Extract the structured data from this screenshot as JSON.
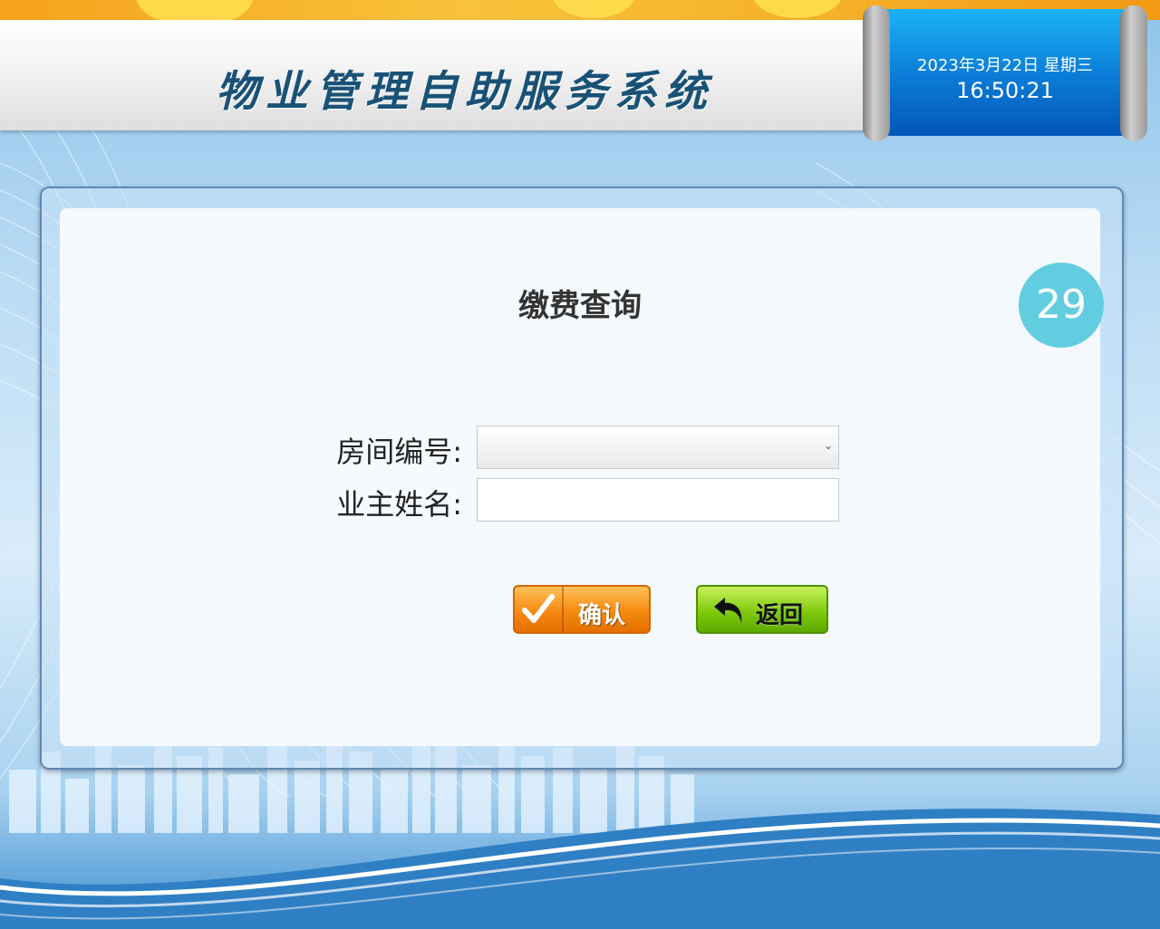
{
  "header": {
    "title": "物业管理自助服务系统"
  },
  "clock": {
    "date": "2023年3月22日 星期三",
    "time": "16:50:21"
  },
  "countdown": "29",
  "form": {
    "title": "缴费查询",
    "room_label": "房间编号:",
    "room_value": "",
    "owner_label": "业主姓名:",
    "owner_value": ""
  },
  "buttons": {
    "confirm_label": "确认",
    "back_label": "返回"
  },
  "colors": {
    "title": "#1a5277",
    "accent_orange": "#f58a10",
    "accent_green": "#7fcc0e",
    "clock_blue": "#0b7fd9",
    "countdown": "#62cde0"
  }
}
